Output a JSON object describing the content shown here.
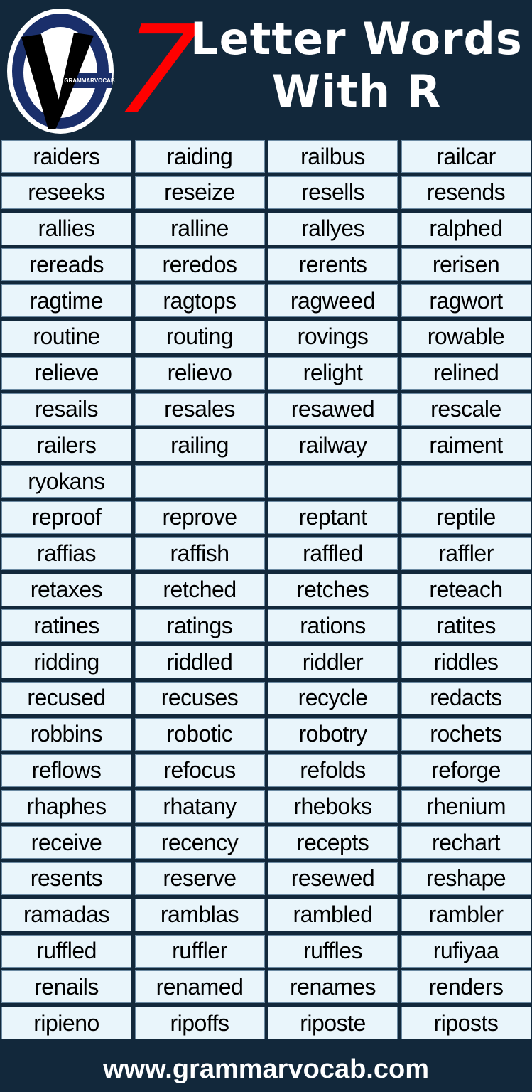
{
  "header": {
    "logo_text": "GRAMMARVOCAB",
    "number": "7",
    "title_line1": "Letter Words",
    "title_line2": "With R"
  },
  "colors": {
    "background": "#12283b",
    "number_red": "#ff0000",
    "cell_fill": "#e9f5fb",
    "logo_ring": "#1a2f6b"
  },
  "words": [
    [
      "raiders",
      "raiding",
      "railbus",
      "railcar"
    ],
    [
      "reseeks",
      "reseize",
      "resells",
      "resends"
    ],
    [
      "rallies",
      "ralline",
      "rallyes",
      "ralphed"
    ],
    [
      "rereads",
      "reredos",
      "rerents",
      "rerisen"
    ],
    [
      "ragtime",
      "ragtops",
      "ragweed",
      "ragwort"
    ],
    [
      "routine",
      "routing",
      "rovings",
      "rowable"
    ],
    [
      "relieve",
      "relievo",
      "relight",
      "relined"
    ],
    [
      "resails",
      "resales",
      "resawed",
      "rescale"
    ],
    [
      "railers",
      "railing",
      "railway",
      "raiment"
    ],
    [
      "ryokans",
      "",
      "",
      ""
    ],
    [
      "reproof",
      "reprove",
      "reptant",
      "reptile"
    ],
    [
      "raffias",
      "raffish",
      "raffled",
      "raffler"
    ],
    [
      "retaxes",
      "retched",
      "retches",
      "reteach"
    ],
    [
      "ratines",
      "ratings",
      "rations",
      "ratites"
    ],
    [
      "ridding",
      "riddled",
      "riddler",
      "riddles"
    ],
    [
      "recused",
      "recuses",
      "recycle",
      "redacts"
    ],
    [
      "robbins",
      "robotic",
      "robotry",
      "rochets"
    ],
    [
      "reflows",
      "refocus",
      "refolds",
      "reforge"
    ],
    [
      "rhaphes",
      "rhatany",
      "rheboks",
      "rhenium"
    ],
    [
      "receive",
      "recency",
      "recepts",
      "rechart"
    ],
    [
      "resents",
      "reserve",
      "resewed",
      "reshape"
    ],
    [
      "ramadas",
      "ramblas",
      "rambled",
      "rambler"
    ],
    [
      "ruffled",
      "ruffler",
      "ruffles",
      "rufiyaa"
    ],
    [
      "renails",
      "renamed",
      "renames",
      "renders"
    ],
    [
      "ripieno",
      "ripoffs",
      "riposte",
      "riposts"
    ]
  ],
  "footer": {
    "url": "www.grammarvocab.com"
  }
}
